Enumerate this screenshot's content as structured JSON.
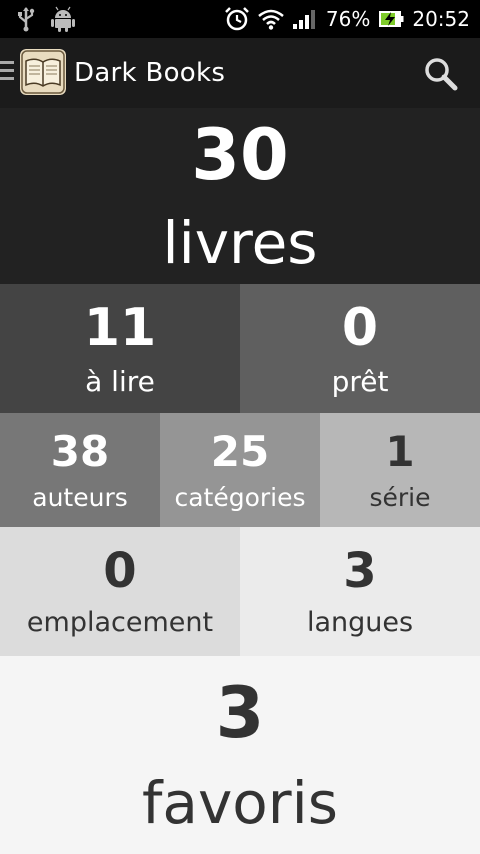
{
  "status_bar": {
    "battery_percent": "76%",
    "time": "20:52",
    "icons": [
      "usb-icon",
      "android-icon",
      "alarm-icon",
      "wifi-icon",
      "signal-icon",
      "battery-charging-icon"
    ]
  },
  "action_bar": {
    "title": "Dark Books",
    "logo_icon": "book-logo-icon",
    "search_icon": "search-icon"
  },
  "stats": {
    "livres": {
      "count": "30",
      "label": "livres"
    },
    "a_lire": {
      "count": "11",
      "label": "à lire"
    },
    "pret": {
      "count": "0",
      "label": "prêt"
    },
    "auteurs": {
      "count": "38",
      "label": "auteurs"
    },
    "categories": {
      "count": "25",
      "label": "catégories"
    },
    "serie": {
      "count": "1",
      "label": "série"
    },
    "emplacement": {
      "count": "0",
      "label": "emplacement"
    },
    "langues": {
      "count": "3",
      "label": "langues"
    },
    "favoris": {
      "count": "3",
      "label": "favoris"
    }
  },
  "colors": {
    "action_bar_bg": "#1b1b1b",
    "tile_livres": "#222222",
    "tile_a_lire": "#444444",
    "tile_pret": "#5f5f5f",
    "tile_auteurs": "#777777",
    "tile_categories": "#959595",
    "tile_serie": "#b7b7b7",
    "tile_emplacement": "#dcdcdc",
    "tile_langues": "#ebebeb",
    "tile_favoris": "#f5f5f5"
  }
}
